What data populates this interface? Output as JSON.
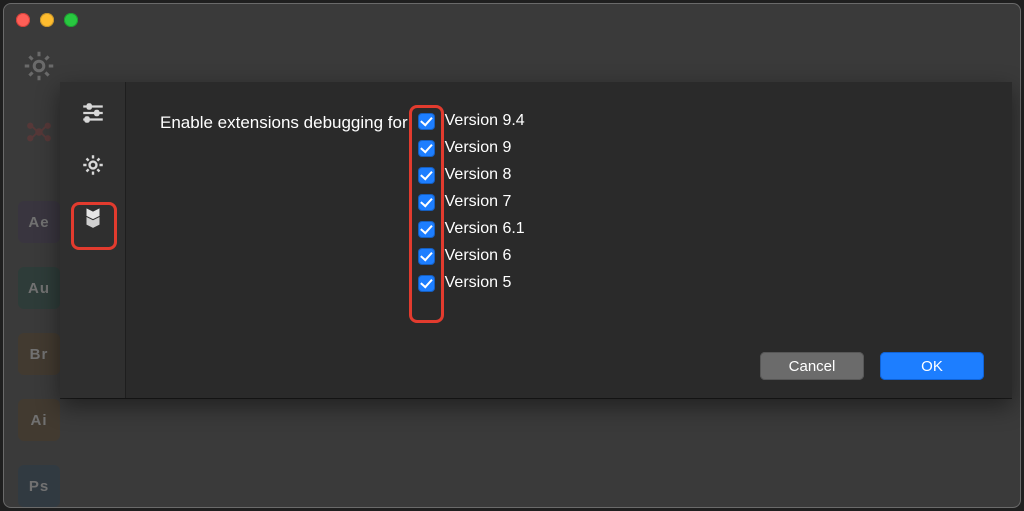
{
  "dock_apps": [
    {
      "name": "app-ae",
      "abbr": "Ae",
      "bg": "#3a2a52"
    },
    {
      "name": "app-au",
      "abbr": "Au",
      "bg": "#0c4437"
    },
    {
      "name": "app-br",
      "abbr": "Br",
      "bg": "#5a3a14"
    },
    {
      "name": "app-ai",
      "abbr": "Ai",
      "bg": "#5a3a14"
    },
    {
      "name": "app-ps",
      "abbr": "Ps",
      "bg": "#1a3a5a"
    }
  ],
  "dialog": {
    "label": "Enable extensions debugging for",
    "versions": [
      {
        "label": "Version 9.4",
        "checked": true
      },
      {
        "label": "Version 9",
        "checked": true
      },
      {
        "label": "Version 8",
        "checked": true
      },
      {
        "label": "Version 7",
        "checked": true
      },
      {
        "label": "Version 6.1",
        "checked": true
      },
      {
        "label": "Version 6",
        "checked": true
      },
      {
        "label": "Version 5",
        "checked": true
      }
    ],
    "cancel": "Cancel",
    "ok": "OK"
  }
}
